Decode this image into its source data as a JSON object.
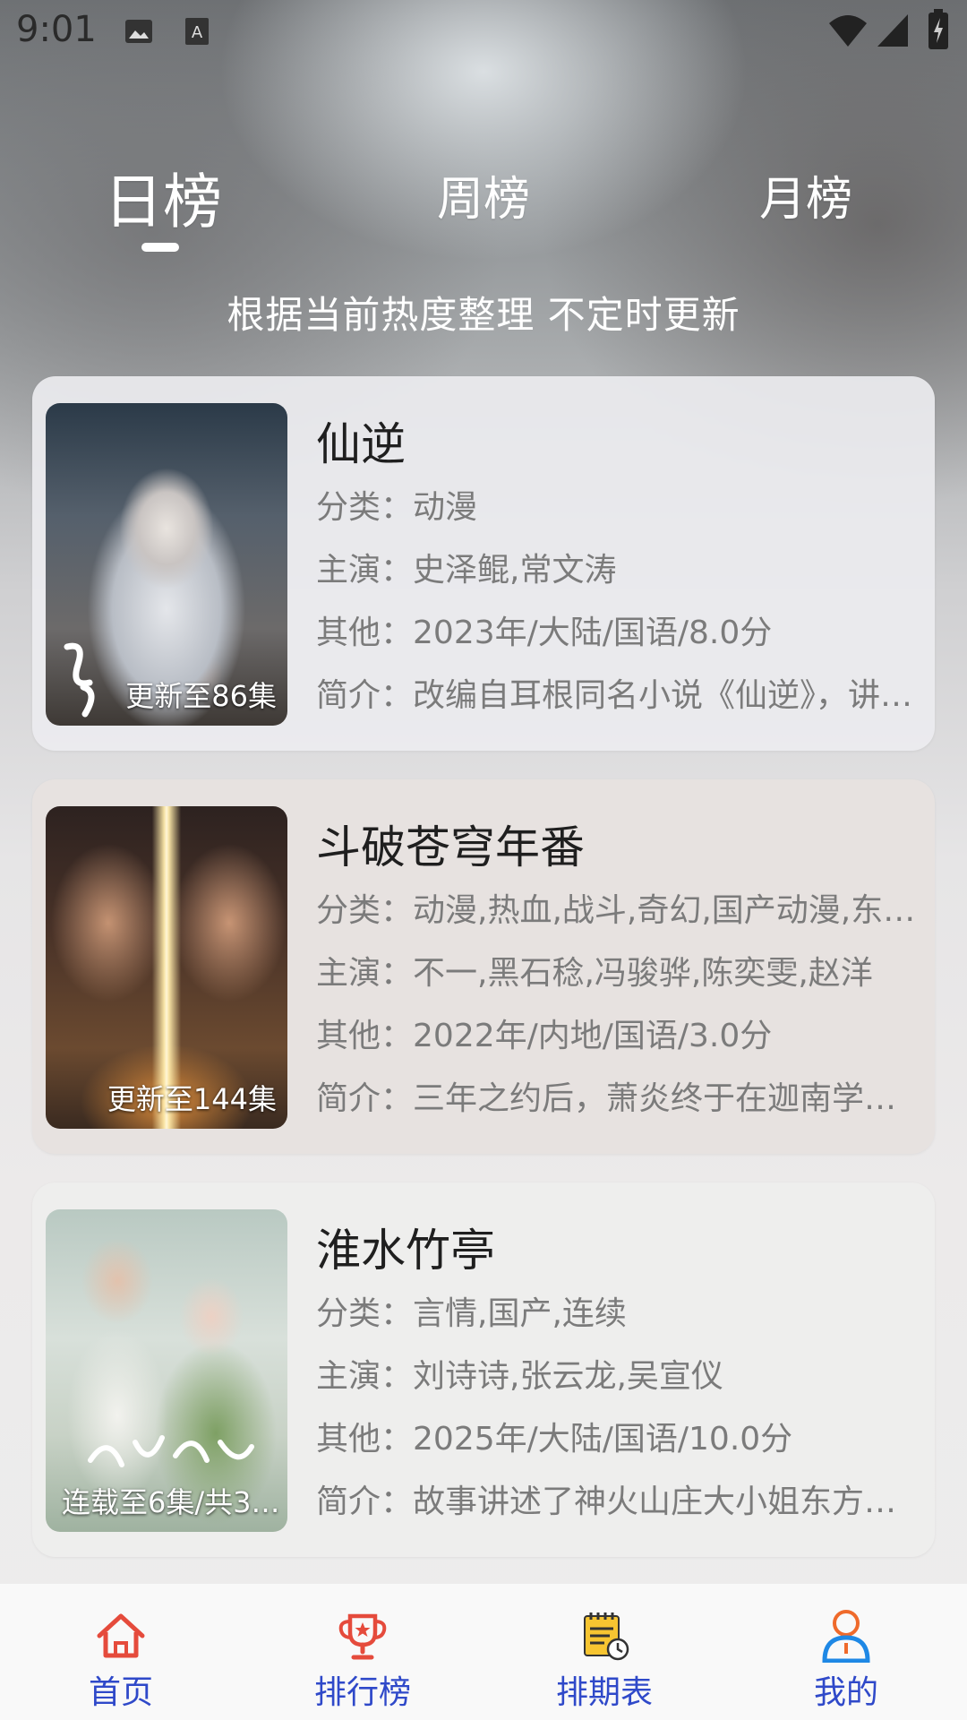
{
  "status_bar": {
    "time": "9:01"
  },
  "tabs": [
    {
      "label": "日榜",
      "active": true
    },
    {
      "label": "周榜",
      "active": false
    },
    {
      "label": "月榜",
      "active": false
    }
  ],
  "subtitle": "根据当前热度整理 不定时更新",
  "items": [
    {
      "title": "仙逆",
      "episode_badge": "更新至86集",
      "category_label": "分类：",
      "category": "动漫",
      "cast_label": "主演：",
      "cast": "史泽鲲,常文涛",
      "other_label": "其他：",
      "other": "2023年/大陆/国语/8.0分",
      "intro_label": "简介：",
      "intro": "改编自耳根同名小说《仙逆》，讲…"
    },
    {
      "title": "斗破苍穹年番",
      "episode_badge": "更新至144集",
      "category_label": "分类：",
      "category": "动漫,热血,战斗,奇幻,国产动漫,东…",
      "cast_label": "主演：",
      "cast": "不一,黑石稔,冯骏骅,陈奕雯,赵洋",
      "other_label": "其他：",
      "other": "2022年/内地/国语/3.0分",
      "intro_label": "简介：",
      "intro": "三年之约后，萧炎终于在迦南学院…"
    },
    {
      "title": "淮水竹亭",
      "episode_badge": "连载至6集/共3…",
      "category_label": "分类：",
      "category": "言情,国产,连续",
      "cast_label": "主演：",
      "cast": "刘诗诗,张云龙,吴宣仪",
      "other_label": "其他：",
      "other": "2025年/大陆/国语/10.0分",
      "intro_label": "简介：",
      "intro": "故事讲述了神火山庄大小姐东方淮…"
    }
  ],
  "bottom_nav": [
    {
      "label": "首页",
      "icon": "home-icon"
    },
    {
      "label": "排行榜",
      "icon": "trophy-icon"
    },
    {
      "label": "排期表",
      "icon": "schedule-icon"
    },
    {
      "label": "我的",
      "icon": "user-icon"
    }
  ],
  "colors": {
    "nav_label": "#2f49c9",
    "nav_icon": "#e54b3c",
    "user_icon": "#1e88e5"
  }
}
